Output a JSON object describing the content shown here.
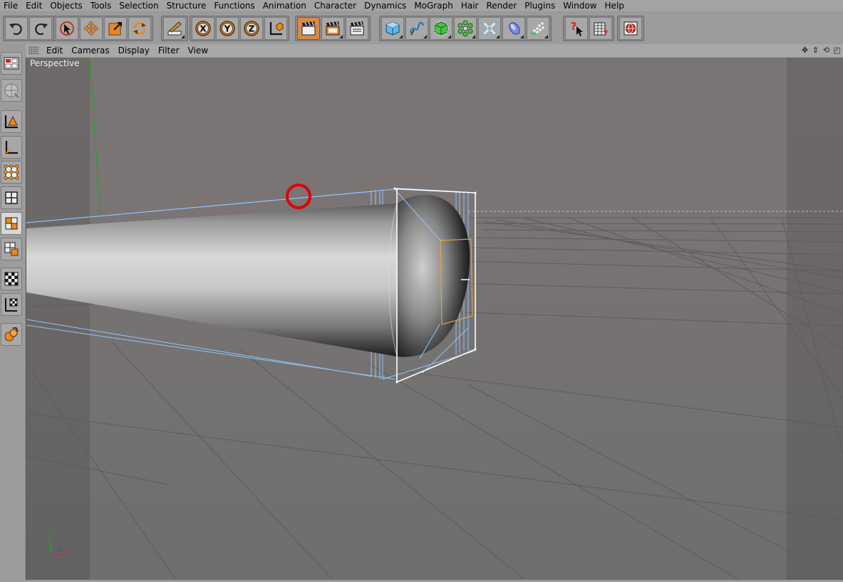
{
  "menubar": {
    "items": [
      "File",
      "Edit",
      "Objects",
      "Tools",
      "Selection",
      "Structure",
      "Functions",
      "Animation",
      "Character",
      "Dynamics",
      "MoGraph",
      "Hair",
      "Render",
      "Plugins",
      "Window",
      "Help"
    ]
  },
  "toolbar": {
    "groups": [
      [
        "undo-icon",
        "redo-icon"
      ],
      [
        "live-selection-icon",
        "move-icon",
        "scale-icon",
        "rotate-icon"
      ],
      [
        "recent-tools-icon"
      ],
      [
        "x-axis-lock-icon",
        "y-axis-lock-icon",
        "z-axis-lock-icon",
        "coordinate-system-icon"
      ],
      [
        "render-view-icon",
        "render-picture-viewer-icon",
        "render-settings-icon"
      ],
      [
        "cube-primitive-icon",
        "spline-icon",
        "nurbs-icon",
        "array-icon",
        "deformer-icon",
        "scene-icon",
        "particles-icon"
      ],
      [
        "help-pointer-icon",
        "content-browser-icon"
      ],
      [
        "internet-icon"
      ]
    ],
    "active": [
      "recent-tools-icon",
      "render-view-icon"
    ],
    "accent_color": "#e8891f"
  },
  "leftbar": {
    "buttons": [
      "layout-icon",
      "texture-mode-icon",
      "object-mode-icon",
      "axis-mode-icon",
      "points-mode-icon",
      "edges-mode-icon",
      "polygons-mode-icon",
      "uvw-mode-icon",
      "checker-icon",
      "texture-axis-icon",
      "sculpt-icon"
    ]
  },
  "viewport": {
    "menus": [
      "Edit",
      "Cameras",
      "Display",
      "Filter",
      "View"
    ],
    "camera_label": "Perspective",
    "nav_icons": [
      "✥",
      "⇕",
      "⟲",
      "◰"
    ],
    "axis_labels": {
      "y": "Y",
      "x": "X",
      "z": "Z"
    },
    "colors": {
      "background": "#777777",
      "grid": "#5a5a5a",
      "selection_box": "#8fc4ff",
      "selection_outline": "#ffffff",
      "highlight_edge": "#e8a13a",
      "cursor_circle": "#e00000",
      "y_axis": "#1aaa1a"
    }
  }
}
